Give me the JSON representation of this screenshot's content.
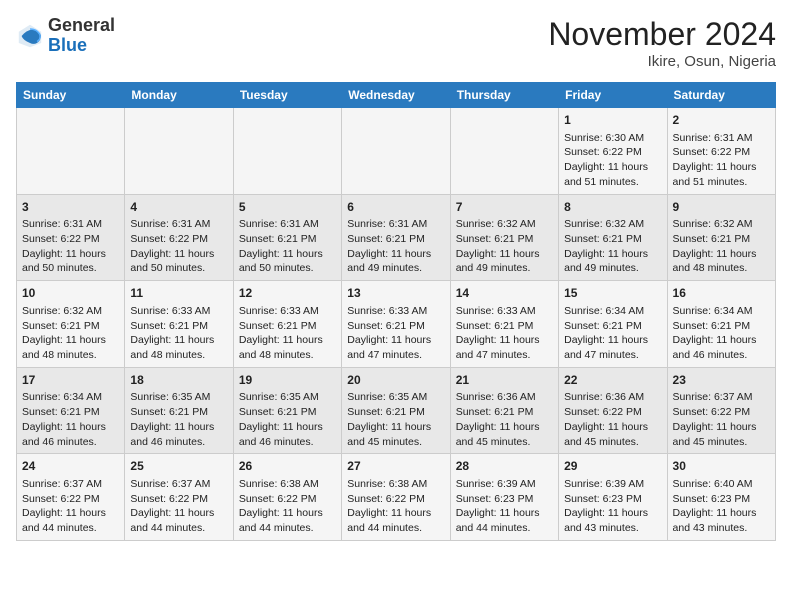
{
  "header": {
    "logo_general": "General",
    "logo_blue": "Blue",
    "month_title": "November 2024",
    "location": "Ikire, Osun, Nigeria"
  },
  "weekdays": [
    "Sunday",
    "Monday",
    "Tuesday",
    "Wednesday",
    "Thursday",
    "Friday",
    "Saturday"
  ],
  "weeks": [
    [
      {
        "day": "",
        "info": ""
      },
      {
        "day": "",
        "info": ""
      },
      {
        "day": "",
        "info": ""
      },
      {
        "day": "",
        "info": ""
      },
      {
        "day": "",
        "info": ""
      },
      {
        "day": "1",
        "info": "Sunrise: 6:30 AM\nSunset: 6:22 PM\nDaylight: 11 hours and 51 minutes."
      },
      {
        "day": "2",
        "info": "Sunrise: 6:31 AM\nSunset: 6:22 PM\nDaylight: 11 hours and 51 minutes."
      }
    ],
    [
      {
        "day": "3",
        "info": "Sunrise: 6:31 AM\nSunset: 6:22 PM\nDaylight: 11 hours and 50 minutes."
      },
      {
        "day": "4",
        "info": "Sunrise: 6:31 AM\nSunset: 6:22 PM\nDaylight: 11 hours and 50 minutes."
      },
      {
        "day": "5",
        "info": "Sunrise: 6:31 AM\nSunset: 6:21 PM\nDaylight: 11 hours and 50 minutes."
      },
      {
        "day": "6",
        "info": "Sunrise: 6:31 AM\nSunset: 6:21 PM\nDaylight: 11 hours and 49 minutes."
      },
      {
        "day": "7",
        "info": "Sunrise: 6:32 AM\nSunset: 6:21 PM\nDaylight: 11 hours and 49 minutes."
      },
      {
        "day": "8",
        "info": "Sunrise: 6:32 AM\nSunset: 6:21 PM\nDaylight: 11 hours and 49 minutes."
      },
      {
        "day": "9",
        "info": "Sunrise: 6:32 AM\nSunset: 6:21 PM\nDaylight: 11 hours and 48 minutes."
      }
    ],
    [
      {
        "day": "10",
        "info": "Sunrise: 6:32 AM\nSunset: 6:21 PM\nDaylight: 11 hours and 48 minutes."
      },
      {
        "day": "11",
        "info": "Sunrise: 6:33 AM\nSunset: 6:21 PM\nDaylight: 11 hours and 48 minutes."
      },
      {
        "day": "12",
        "info": "Sunrise: 6:33 AM\nSunset: 6:21 PM\nDaylight: 11 hours and 48 minutes."
      },
      {
        "day": "13",
        "info": "Sunrise: 6:33 AM\nSunset: 6:21 PM\nDaylight: 11 hours and 47 minutes."
      },
      {
        "day": "14",
        "info": "Sunrise: 6:33 AM\nSunset: 6:21 PM\nDaylight: 11 hours and 47 minutes."
      },
      {
        "day": "15",
        "info": "Sunrise: 6:34 AM\nSunset: 6:21 PM\nDaylight: 11 hours and 47 minutes."
      },
      {
        "day": "16",
        "info": "Sunrise: 6:34 AM\nSunset: 6:21 PM\nDaylight: 11 hours and 46 minutes."
      }
    ],
    [
      {
        "day": "17",
        "info": "Sunrise: 6:34 AM\nSunset: 6:21 PM\nDaylight: 11 hours and 46 minutes."
      },
      {
        "day": "18",
        "info": "Sunrise: 6:35 AM\nSunset: 6:21 PM\nDaylight: 11 hours and 46 minutes."
      },
      {
        "day": "19",
        "info": "Sunrise: 6:35 AM\nSunset: 6:21 PM\nDaylight: 11 hours and 46 minutes."
      },
      {
        "day": "20",
        "info": "Sunrise: 6:35 AM\nSunset: 6:21 PM\nDaylight: 11 hours and 45 minutes."
      },
      {
        "day": "21",
        "info": "Sunrise: 6:36 AM\nSunset: 6:21 PM\nDaylight: 11 hours and 45 minutes."
      },
      {
        "day": "22",
        "info": "Sunrise: 6:36 AM\nSunset: 6:22 PM\nDaylight: 11 hours and 45 minutes."
      },
      {
        "day": "23",
        "info": "Sunrise: 6:37 AM\nSunset: 6:22 PM\nDaylight: 11 hours and 45 minutes."
      }
    ],
    [
      {
        "day": "24",
        "info": "Sunrise: 6:37 AM\nSunset: 6:22 PM\nDaylight: 11 hours and 44 minutes."
      },
      {
        "day": "25",
        "info": "Sunrise: 6:37 AM\nSunset: 6:22 PM\nDaylight: 11 hours and 44 minutes."
      },
      {
        "day": "26",
        "info": "Sunrise: 6:38 AM\nSunset: 6:22 PM\nDaylight: 11 hours and 44 minutes."
      },
      {
        "day": "27",
        "info": "Sunrise: 6:38 AM\nSunset: 6:22 PM\nDaylight: 11 hours and 44 minutes."
      },
      {
        "day": "28",
        "info": "Sunrise: 6:39 AM\nSunset: 6:23 PM\nDaylight: 11 hours and 44 minutes."
      },
      {
        "day": "29",
        "info": "Sunrise: 6:39 AM\nSunset: 6:23 PM\nDaylight: 11 hours and 43 minutes."
      },
      {
        "day": "30",
        "info": "Sunrise: 6:40 AM\nSunset: 6:23 PM\nDaylight: 11 hours and 43 minutes."
      }
    ]
  ]
}
